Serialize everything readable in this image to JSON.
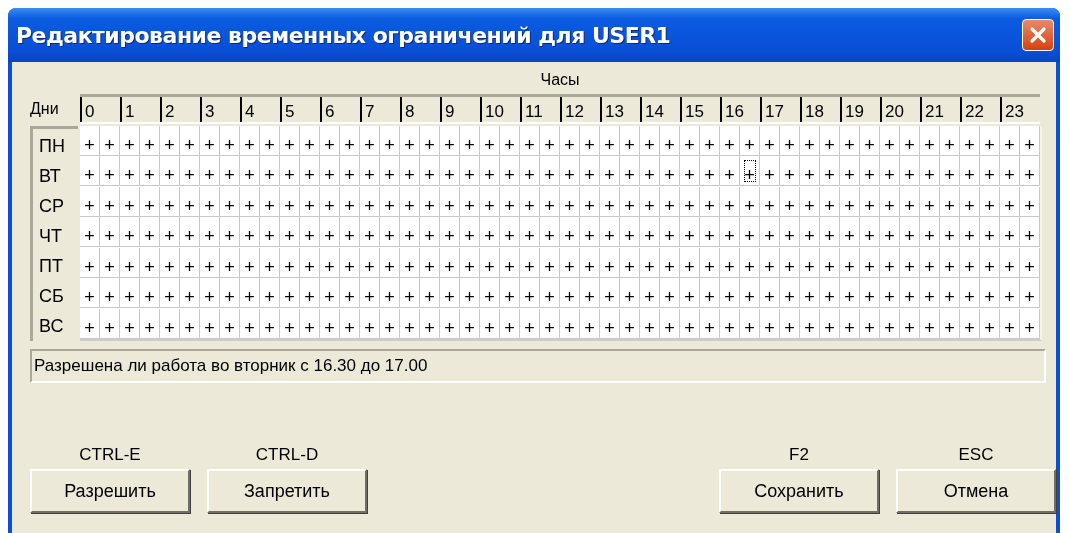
{
  "window": {
    "title": "Редактирование временных ограничений для USER1"
  },
  "grid": {
    "hours_caption": "Часы",
    "days_caption": "Дни",
    "hours": [
      "0",
      "1",
      "2",
      "3",
      "4",
      "5",
      "6",
      "7",
      "8",
      "9",
      "10",
      "11",
      "12",
      "13",
      "14",
      "15",
      "16",
      "17",
      "18",
      "19",
      "20",
      "21",
      "22",
      "23"
    ],
    "days": [
      {
        "label": "ПН",
        "cells": [
          {
            "text": "+",
            "focused": false
          },
          {
            "text": "+",
            "focused": false
          },
          {
            "text": "+",
            "focused": false
          },
          {
            "text": "+",
            "focused": false
          },
          {
            "text": "+",
            "focused": false
          },
          {
            "text": "+",
            "focused": false
          },
          {
            "text": "+",
            "focused": false
          },
          {
            "text": "+",
            "focused": false
          },
          {
            "text": "+",
            "focused": false
          },
          {
            "text": "+",
            "focused": false
          },
          {
            "text": "+",
            "focused": false
          },
          {
            "text": "+",
            "focused": false
          },
          {
            "text": "+",
            "focused": false
          },
          {
            "text": "+",
            "focused": false
          },
          {
            "text": "+",
            "focused": false
          },
          {
            "text": "+",
            "focused": false
          },
          {
            "text": "+",
            "focused": false
          },
          {
            "text": "+",
            "focused": false
          },
          {
            "text": "+",
            "focused": false
          },
          {
            "text": "+",
            "focused": false
          },
          {
            "text": "+",
            "focused": false
          },
          {
            "text": "+",
            "focused": false
          },
          {
            "text": "+",
            "focused": false
          },
          {
            "text": "+",
            "focused": false
          },
          {
            "text": "+",
            "focused": false
          },
          {
            "text": "+",
            "focused": false
          },
          {
            "text": "+",
            "focused": false
          },
          {
            "text": "+",
            "focused": false
          },
          {
            "text": "+",
            "focused": false
          },
          {
            "text": "+",
            "focused": false
          },
          {
            "text": "+",
            "focused": false
          },
          {
            "text": "+",
            "focused": false
          },
          {
            "text": "+",
            "focused": false
          },
          {
            "text": "+",
            "focused": false
          },
          {
            "text": "+",
            "focused": false
          },
          {
            "text": "+",
            "focused": false
          },
          {
            "text": "+",
            "focused": false
          },
          {
            "text": "+",
            "focused": false
          },
          {
            "text": "+",
            "focused": false
          },
          {
            "text": "+",
            "focused": false
          },
          {
            "text": "+",
            "focused": false
          },
          {
            "text": "+",
            "focused": false
          },
          {
            "text": "+",
            "focused": false
          },
          {
            "text": "+",
            "focused": false
          },
          {
            "text": "+",
            "focused": false
          },
          {
            "text": "+",
            "focused": false
          },
          {
            "text": "+",
            "focused": false
          },
          {
            "text": "+",
            "focused": false
          }
        ]
      },
      {
        "label": "ВТ",
        "cells": [
          {
            "text": "+",
            "focused": false
          },
          {
            "text": "+",
            "focused": false
          },
          {
            "text": "+",
            "focused": false
          },
          {
            "text": "+",
            "focused": false
          },
          {
            "text": "+",
            "focused": false
          },
          {
            "text": "+",
            "focused": false
          },
          {
            "text": "+",
            "focused": false
          },
          {
            "text": "+",
            "focused": false
          },
          {
            "text": "+",
            "focused": false
          },
          {
            "text": "+",
            "focused": false
          },
          {
            "text": "+",
            "focused": false
          },
          {
            "text": "+",
            "focused": false
          },
          {
            "text": "+",
            "focused": false
          },
          {
            "text": "+",
            "focused": false
          },
          {
            "text": "+",
            "focused": false
          },
          {
            "text": "+",
            "focused": false
          },
          {
            "text": "+",
            "focused": false
          },
          {
            "text": "+",
            "focused": false
          },
          {
            "text": "+",
            "focused": false
          },
          {
            "text": "+",
            "focused": false
          },
          {
            "text": "+",
            "focused": false
          },
          {
            "text": "+",
            "focused": false
          },
          {
            "text": "+",
            "focused": false
          },
          {
            "text": "+",
            "focused": false
          },
          {
            "text": "+",
            "focused": false
          },
          {
            "text": "+",
            "focused": false
          },
          {
            "text": "+",
            "focused": false
          },
          {
            "text": "+",
            "focused": false
          },
          {
            "text": "+",
            "focused": false
          },
          {
            "text": "+",
            "focused": false
          },
          {
            "text": "+",
            "focused": false
          },
          {
            "text": "+",
            "focused": false
          },
          {
            "text": "+",
            "focused": false
          },
          {
            "text": "+",
            "focused": true
          },
          {
            "text": "+",
            "focused": false
          },
          {
            "text": "+",
            "focused": false
          },
          {
            "text": "+",
            "focused": false
          },
          {
            "text": "+",
            "focused": false
          },
          {
            "text": "+",
            "focused": false
          },
          {
            "text": "+",
            "focused": false
          },
          {
            "text": "+",
            "focused": false
          },
          {
            "text": "+",
            "focused": false
          },
          {
            "text": "+",
            "focused": false
          },
          {
            "text": "+",
            "focused": false
          },
          {
            "text": "+",
            "focused": false
          },
          {
            "text": "+",
            "focused": false
          },
          {
            "text": "+",
            "focused": false
          },
          {
            "text": "+",
            "focused": false
          }
        ]
      },
      {
        "label": "СР",
        "cells": [
          {
            "text": "+",
            "focused": false
          },
          {
            "text": "+",
            "focused": false
          },
          {
            "text": "+",
            "focused": false
          },
          {
            "text": "+",
            "focused": false
          },
          {
            "text": "+",
            "focused": false
          },
          {
            "text": "+",
            "focused": false
          },
          {
            "text": "+",
            "focused": false
          },
          {
            "text": "+",
            "focused": false
          },
          {
            "text": "+",
            "focused": false
          },
          {
            "text": "+",
            "focused": false
          },
          {
            "text": "+",
            "focused": false
          },
          {
            "text": "+",
            "focused": false
          },
          {
            "text": "+",
            "focused": false
          },
          {
            "text": "+",
            "focused": false
          },
          {
            "text": "+",
            "focused": false
          },
          {
            "text": "+",
            "focused": false
          },
          {
            "text": "+",
            "focused": false
          },
          {
            "text": "+",
            "focused": false
          },
          {
            "text": "+",
            "focused": false
          },
          {
            "text": "+",
            "focused": false
          },
          {
            "text": "+",
            "focused": false
          },
          {
            "text": "+",
            "focused": false
          },
          {
            "text": "+",
            "focused": false
          },
          {
            "text": "+",
            "focused": false
          },
          {
            "text": "+",
            "focused": false
          },
          {
            "text": "+",
            "focused": false
          },
          {
            "text": "+",
            "focused": false
          },
          {
            "text": "+",
            "focused": false
          },
          {
            "text": "+",
            "focused": false
          },
          {
            "text": "+",
            "focused": false
          },
          {
            "text": "+",
            "focused": false
          },
          {
            "text": "+",
            "focused": false
          },
          {
            "text": "+",
            "focused": false
          },
          {
            "text": "+",
            "focused": false
          },
          {
            "text": "+",
            "focused": false
          },
          {
            "text": "+",
            "focused": false
          },
          {
            "text": "+",
            "focused": false
          },
          {
            "text": "+",
            "focused": false
          },
          {
            "text": "+",
            "focused": false
          },
          {
            "text": "+",
            "focused": false
          },
          {
            "text": "+",
            "focused": false
          },
          {
            "text": "+",
            "focused": false
          },
          {
            "text": "+",
            "focused": false
          },
          {
            "text": "+",
            "focused": false
          },
          {
            "text": "+",
            "focused": false
          },
          {
            "text": "+",
            "focused": false
          },
          {
            "text": "+",
            "focused": false
          },
          {
            "text": "+",
            "focused": false
          }
        ]
      },
      {
        "label": "ЧТ",
        "cells": [
          {
            "text": "+",
            "focused": false
          },
          {
            "text": "+",
            "focused": false
          },
          {
            "text": "+",
            "focused": false
          },
          {
            "text": "+",
            "focused": false
          },
          {
            "text": "+",
            "focused": false
          },
          {
            "text": "+",
            "focused": false
          },
          {
            "text": "+",
            "focused": false
          },
          {
            "text": "+",
            "focused": false
          },
          {
            "text": "+",
            "focused": false
          },
          {
            "text": "+",
            "focused": false
          },
          {
            "text": "+",
            "focused": false
          },
          {
            "text": "+",
            "focused": false
          },
          {
            "text": "+",
            "focused": false
          },
          {
            "text": "+",
            "focused": false
          },
          {
            "text": "+",
            "focused": false
          },
          {
            "text": "+",
            "focused": false
          },
          {
            "text": "+",
            "focused": false
          },
          {
            "text": "+",
            "focused": false
          },
          {
            "text": "+",
            "focused": false
          },
          {
            "text": "+",
            "focused": false
          },
          {
            "text": "+",
            "focused": false
          },
          {
            "text": "+",
            "focused": false
          },
          {
            "text": "+",
            "focused": false
          },
          {
            "text": "+",
            "focused": false
          },
          {
            "text": "+",
            "focused": false
          },
          {
            "text": "+",
            "focused": false
          },
          {
            "text": "+",
            "focused": false
          },
          {
            "text": "+",
            "focused": false
          },
          {
            "text": "+",
            "focused": false
          },
          {
            "text": "+",
            "focused": false
          },
          {
            "text": "+",
            "focused": false
          },
          {
            "text": "+",
            "focused": false
          },
          {
            "text": "+",
            "focused": false
          },
          {
            "text": "+",
            "focused": false
          },
          {
            "text": "+",
            "focused": false
          },
          {
            "text": "+",
            "focused": false
          },
          {
            "text": "+",
            "focused": false
          },
          {
            "text": "+",
            "focused": false
          },
          {
            "text": "+",
            "focused": false
          },
          {
            "text": "+",
            "focused": false
          },
          {
            "text": "+",
            "focused": false
          },
          {
            "text": "+",
            "focused": false
          },
          {
            "text": "+",
            "focused": false
          },
          {
            "text": "+",
            "focused": false
          },
          {
            "text": "+",
            "focused": false
          },
          {
            "text": "+",
            "focused": false
          },
          {
            "text": "+",
            "focused": false
          },
          {
            "text": "+",
            "focused": false
          }
        ]
      },
      {
        "label": "ПТ",
        "cells": [
          {
            "text": "+",
            "focused": false
          },
          {
            "text": "+",
            "focused": false
          },
          {
            "text": "+",
            "focused": false
          },
          {
            "text": "+",
            "focused": false
          },
          {
            "text": "+",
            "focused": false
          },
          {
            "text": "+",
            "focused": false
          },
          {
            "text": "+",
            "focused": false
          },
          {
            "text": "+",
            "focused": false
          },
          {
            "text": "+",
            "focused": false
          },
          {
            "text": "+",
            "focused": false
          },
          {
            "text": "+",
            "focused": false
          },
          {
            "text": "+",
            "focused": false
          },
          {
            "text": "+",
            "focused": false
          },
          {
            "text": "+",
            "focused": false
          },
          {
            "text": "+",
            "focused": false
          },
          {
            "text": "+",
            "focused": false
          },
          {
            "text": "+",
            "focused": false
          },
          {
            "text": "+",
            "focused": false
          },
          {
            "text": "+",
            "focused": false
          },
          {
            "text": "+",
            "focused": false
          },
          {
            "text": "+",
            "focused": false
          },
          {
            "text": "+",
            "focused": false
          },
          {
            "text": "+",
            "focused": false
          },
          {
            "text": "+",
            "focused": false
          },
          {
            "text": "+",
            "focused": false
          },
          {
            "text": "+",
            "focused": false
          },
          {
            "text": "+",
            "focused": false
          },
          {
            "text": "+",
            "focused": false
          },
          {
            "text": "+",
            "focused": false
          },
          {
            "text": "+",
            "focused": false
          },
          {
            "text": "+",
            "focused": false
          },
          {
            "text": "+",
            "focused": false
          },
          {
            "text": "+",
            "focused": false
          },
          {
            "text": "+",
            "focused": false
          },
          {
            "text": "+",
            "focused": false
          },
          {
            "text": "+",
            "focused": false
          },
          {
            "text": "+",
            "focused": false
          },
          {
            "text": "+",
            "focused": false
          },
          {
            "text": "+",
            "focused": false
          },
          {
            "text": "+",
            "focused": false
          },
          {
            "text": "+",
            "focused": false
          },
          {
            "text": "+",
            "focused": false
          },
          {
            "text": "+",
            "focused": false
          },
          {
            "text": "+",
            "focused": false
          },
          {
            "text": "+",
            "focused": false
          },
          {
            "text": "+",
            "focused": false
          },
          {
            "text": "+",
            "focused": false
          },
          {
            "text": "+",
            "focused": false
          }
        ]
      },
      {
        "label": "СБ",
        "cells": [
          {
            "text": "+",
            "focused": false
          },
          {
            "text": "+",
            "focused": false
          },
          {
            "text": "+",
            "focused": false
          },
          {
            "text": "+",
            "focused": false
          },
          {
            "text": "+",
            "focused": false
          },
          {
            "text": "+",
            "focused": false
          },
          {
            "text": "+",
            "focused": false
          },
          {
            "text": "+",
            "focused": false
          },
          {
            "text": "+",
            "focused": false
          },
          {
            "text": "+",
            "focused": false
          },
          {
            "text": "+",
            "focused": false
          },
          {
            "text": "+",
            "focused": false
          },
          {
            "text": "+",
            "focused": false
          },
          {
            "text": "+",
            "focused": false
          },
          {
            "text": "+",
            "focused": false
          },
          {
            "text": "+",
            "focused": false
          },
          {
            "text": "+",
            "focused": false
          },
          {
            "text": "+",
            "focused": false
          },
          {
            "text": "+",
            "focused": false
          },
          {
            "text": "+",
            "focused": false
          },
          {
            "text": "+",
            "focused": false
          },
          {
            "text": "+",
            "focused": false
          },
          {
            "text": "+",
            "focused": false
          },
          {
            "text": "+",
            "focused": false
          },
          {
            "text": "+",
            "focused": false
          },
          {
            "text": "+",
            "focused": false
          },
          {
            "text": "+",
            "focused": false
          },
          {
            "text": "+",
            "focused": false
          },
          {
            "text": "+",
            "focused": false
          },
          {
            "text": "+",
            "focused": false
          },
          {
            "text": "+",
            "focused": false
          },
          {
            "text": "+",
            "focused": false
          },
          {
            "text": "+",
            "focused": false
          },
          {
            "text": "+",
            "focused": false
          },
          {
            "text": "+",
            "focused": false
          },
          {
            "text": "+",
            "focused": false
          },
          {
            "text": "+",
            "focused": false
          },
          {
            "text": "+",
            "focused": false
          },
          {
            "text": "+",
            "focused": false
          },
          {
            "text": "+",
            "focused": false
          },
          {
            "text": "+",
            "focused": false
          },
          {
            "text": "+",
            "focused": false
          },
          {
            "text": "+",
            "focused": false
          },
          {
            "text": "+",
            "focused": false
          },
          {
            "text": "+",
            "focused": false
          },
          {
            "text": "+",
            "focused": false
          },
          {
            "text": "+",
            "focused": false
          },
          {
            "text": "+",
            "focused": false
          }
        ]
      },
      {
        "label": "ВС",
        "cells": [
          {
            "text": "+",
            "focused": false
          },
          {
            "text": "+",
            "focused": false
          },
          {
            "text": "+",
            "focused": false
          },
          {
            "text": "+",
            "focused": false
          },
          {
            "text": "+",
            "focused": false
          },
          {
            "text": "+",
            "focused": false
          },
          {
            "text": "+",
            "focused": false
          },
          {
            "text": "+",
            "focused": false
          },
          {
            "text": "+",
            "focused": false
          },
          {
            "text": "+",
            "focused": false
          },
          {
            "text": "+",
            "focused": false
          },
          {
            "text": "+",
            "focused": false
          },
          {
            "text": "+",
            "focused": false
          },
          {
            "text": "+",
            "focused": false
          },
          {
            "text": "+",
            "focused": false
          },
          {
            "text": "+",
            "focused": false
          },
          {
            "text": "+",
            "focused": false
          },
          {
            "text": "+",
            "focused": false
          },
          {
            "text": "+",
            "focused": false
          },
          {
            "text": "+",
            "focused": false
          },
          {
            "text": "+",
            "focused": false
          },
          {
            "text": "+",
            "focused": false
          },
          {
            "text": "+",
            "focused": false
          },
          {
            "text": "+",
            "focused": false
          },
          {
            "text": "+",
            "focused": false
          },
          {
            "text": "+",
            "focused": false
          },
          {
            "text": "+",
            "focused": false
          },
          {
            "text": "+",
            "focused": false
          },
          {
            "text": "+",
            "focused": false
          },
          {
            "text": "+",
            "focused": false
          },
          {
            "text": "+",
            "focused": false
          },
          {
            "text": "+",
            "focused": false
          },
          {
            "text": "+",
            "focused": false
          },
          {
            "text": "+",
            "focused": false
          },
          {
            "text": "+",
            "focused": false
          },
          {
            "text": "+",
            "focused": false
          },
          {
            "text": "+",
            "focused": false
          },
          {
            "text": "+",
            "focused": false
          },
          {
            "text": "+",
            "focused": false
          },
          {
            "text": "+",
            "focused": false
          },
          {
            "text": "+",
            "focused": false
          },
          {
            "text": "+",
            "focused": false
          },
          {
            "text": "+",
            "focused": false
          },
          {
            "text": "+",
            "focused": false
          },
          {
            "text": "+",
            "focused": false
          },
          {
            "text": "+",
            "focused": false
          },
          {
            "text": "+",
            "focused": false
          },
          {
            "text": "+",
            "focused": false
          }
        ]
      }
    ]
  },
  "status_bar": {
    "text": "Разрешена ли работа во вторник с 16.30 до 17.00"
  },
  "left_buttons": [
    {
      "shortcut": "CTRL-E",
      "label": "Разрешить"
    },
    {
      "shortcut": "CTRL-D",
      "label": "Запретить"
    }
  ],
  "right_buttons": [
    {
      "shortcut": "F2",
      "label": "Сохранить"
    },
    {
      "shortcut": "ESC",
      "label": "Отмена"
    }
  ]
}
